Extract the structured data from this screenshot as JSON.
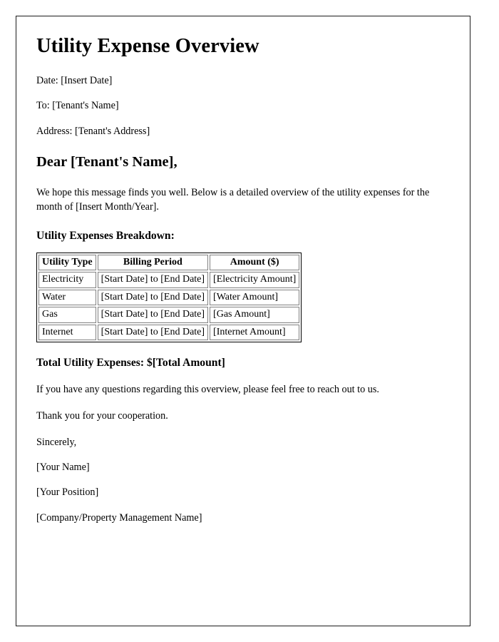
{
  "document": {
    "title": "Utility Expense Overview",
    "meta": [
      {
        "name": "date",
        "text": "Date: [Insert Date]"
      },
      {
        "name": "recipient",
        "text": "To: [Tenant's Name]"
      },
      {
        "name": "address",
        "text": "Address: [Tenant's Address]"
      }
    ],
    "salutation": "Dear [Tenant's Name],",
    "intro_paragraph": "We hope this message finds you well. Below is a detailed overview of the utility expenses for the month of [Insert Month/Year].",
    "breakdown_heading": "Utility Expenses Breakdown:",
    "table": {
      "columns": [
        "Utility Type",
        "Billing Period",
        "Amount ($)"
      ],
      "rows": [
        [
          "Electricity",
          "[Start Date] to [End Date]",
          "[Electricity Amount]"
        ],
        [
          "Water",
          "[Start Date] to [End Date]",
          "[Water Amount]"
        ],
        [
          "Gas",
          "[Start Date] to [End Date]",
          "[Gas Amount]"
        ],
        [
          "Internet",
          "[Start Date] to [End Date]",
          "[Internet Amount]"
        ]
      ]
    },
    "total_line": "Total Utility Expenses: $[Total Amount]",
    "closing_paragraphs": [
      "If you have any questions regarding this overview, please feel free to reach out to us.",
      "Thank you for your cooperation."
    ],
    "signature": [
      "Sincerely,",
      "[Your Name]",
      "[Your Position]",
      "[Company/Property Management Name]"
    ]
  }
}
